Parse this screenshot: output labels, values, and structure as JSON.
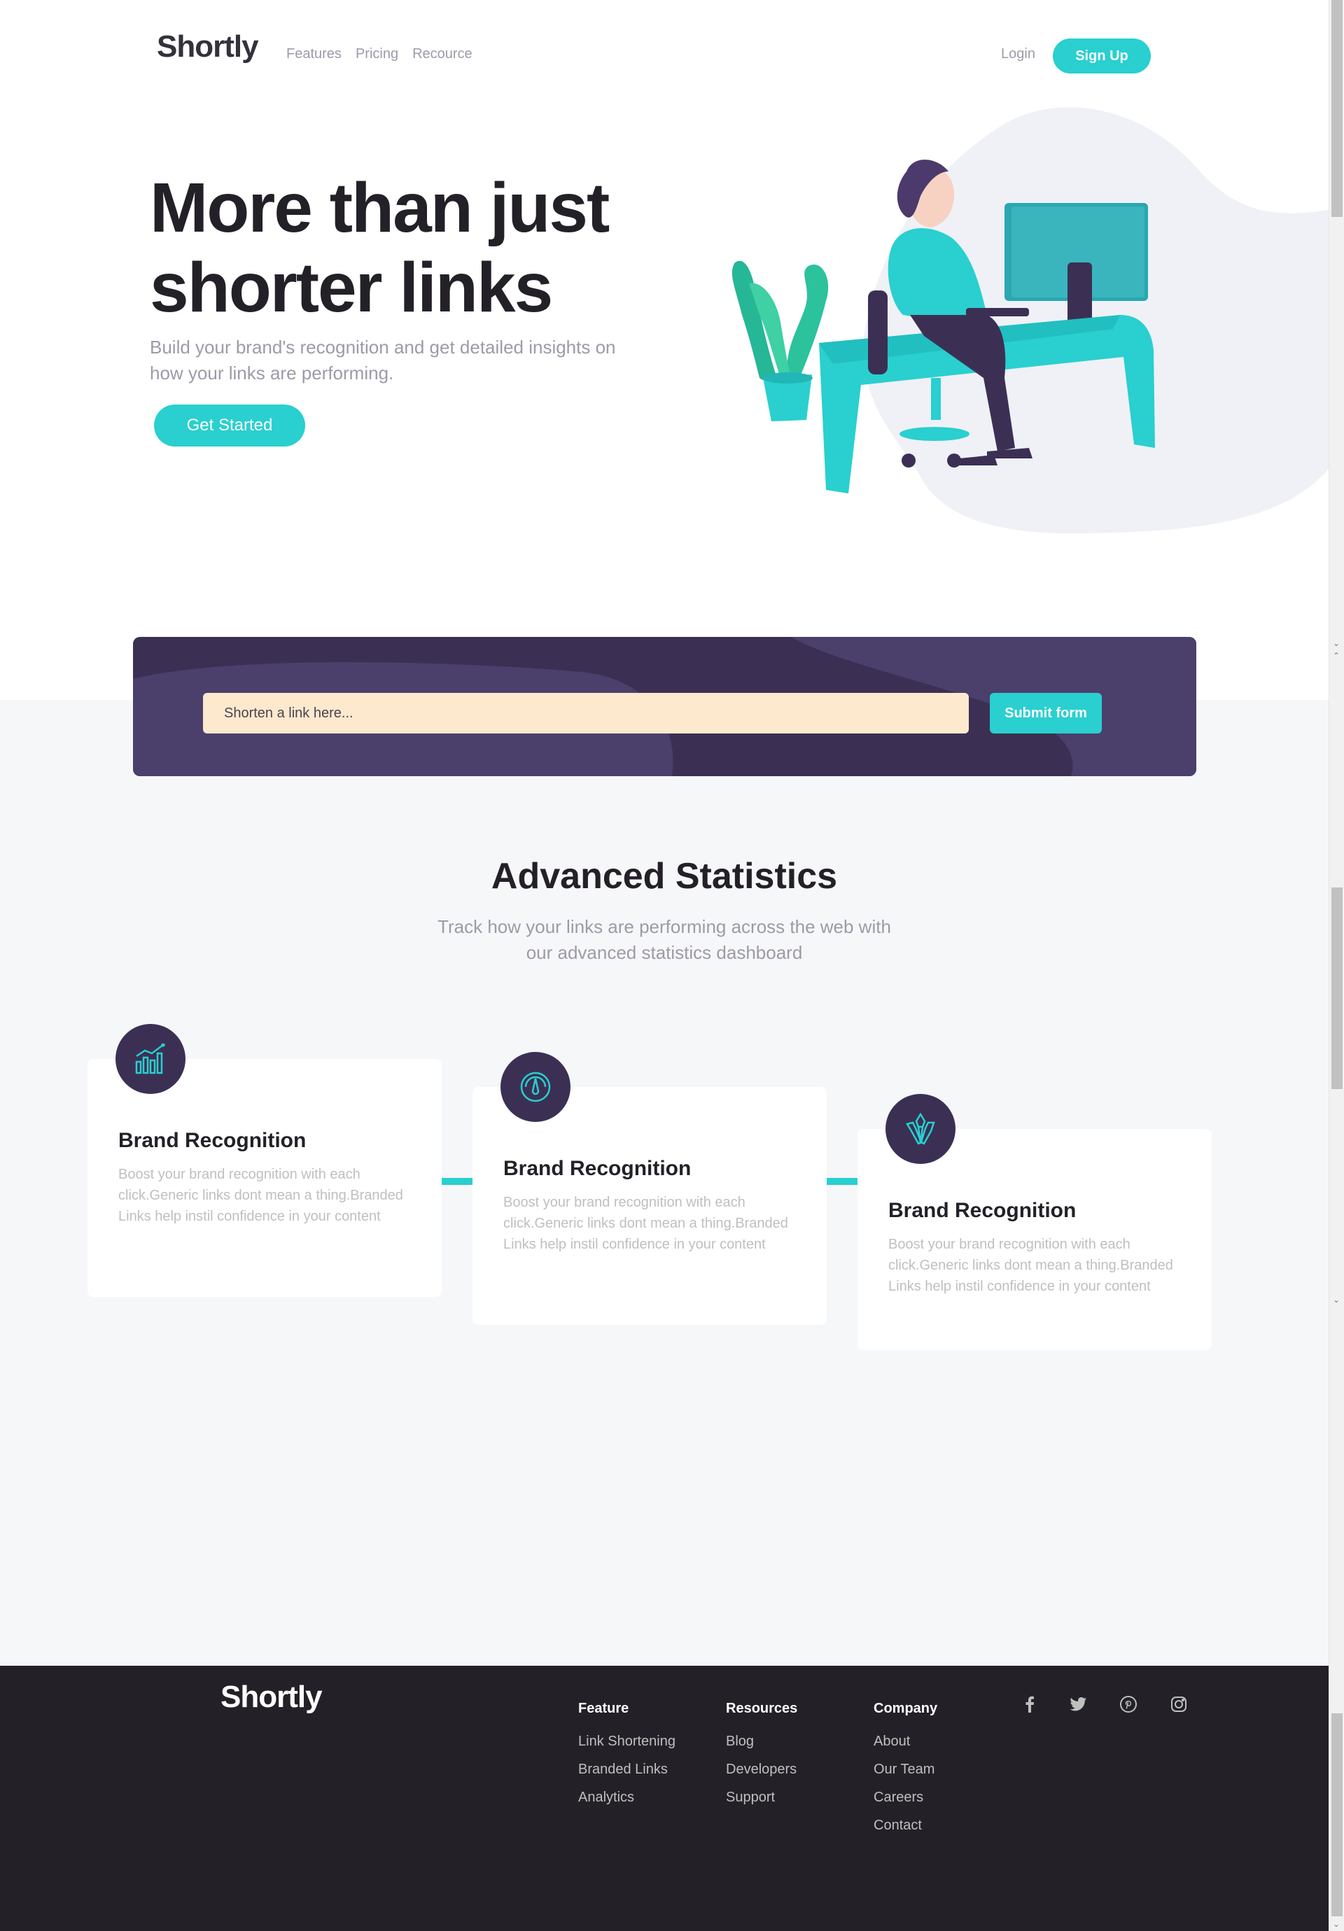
{
  "header": {
    "logo": "Shortly",
    "nav": [
      "Features",
      "Pricing",
      "Recource"
    ],
    "login": "Login",
    "signup": "Sign Up"
  },
  "hero": {
    "title": "More than just shorter links",
    "subtitle": "Build your brand's recognition and get detailed insights on how your links are performing.",
    "cta": "Get Started"
  },
  "shorten": {
    "placeholder": "Shorten a link here...",
    "submit": "Submit form"
  },
  "stats": {
    "title": "Advanced Statistics",
    "subtitle": "Track how your links are performing across the web with our advanced statistics dashboard",
    "cards": [
      {
        "icon": "chart-icon",
        "title": "Brand Recognition",
        "text": "Boost your brand recognition with each click.Generic links dont mean a thing.Branded Links help instil confidence in your content"
      },
      {
        "icon": "gauge-icon",
        "title": "Brand Recognition",
        "text": "Boost your brand recognition with each click.Generic links dont mean a thing.Branded Links help instil confidence in your content"
      },
      {
        "icon": "brushes-icon",
        "title": "Brand Recognition",
        "text": "Boost your brand recognition with each click.Generic links dont mean a thing.Branded Links help instil confidence in your content"
      }
    ]
  },
  "footer": {
    "logo": "Shortly",
    "columns": [
      {
        "title": "Feature",
        "links": [
          "Link Shortening",
          "Branded Links",
          "Analytics"
        ]
      },
      {
        "title": "Resources",
        "links": [
          "Blog",
          "Developers",
          "Support"
        ]
      },
      {
        "title": "Company",
        "links": [
          "About",
          "Our Team",
          "Careers",
          "Contact"
        ]
      }
    ],
    "social": [
      "facebook-icon",
      "twitter-icon",
      "pinterest-icon",
      "instagram-icon"
    ]
  },
  "colors": {
    "accent": "#2acfcf",
    "dark_violet": "#3b3054",
    "footer_bg": "#232127",
    "input_bg": "#fde9cd"
  }
}
